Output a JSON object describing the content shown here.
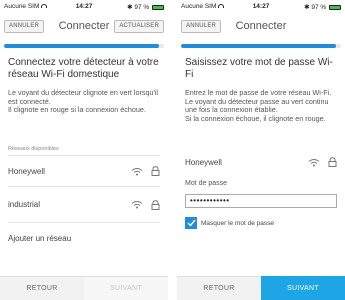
{
  "colors": {
    "accent": "#1f8ddb",
    "footer_active": "#1ea5e6",
    "battery": "#3cc152"
  },
  "left": {
    "status": {
      "carrier": "Aucune SIM",
      "time": "14:27",
      "battery": "97 %"
    },
    "nav": {
      "cancel": "ANNULER",
      "title": "Connecter",
      "refresh": "ACTUALISER"
    },
    "progress": 0.97,
    "heading": "Connectez votre détecteur à votre réseau Wi-Fi domestique",
    "description": "Le voyant du détecteur clignote en vert lorsqu'il est connecté.\nIl clignote en rouge si la connexion échoue.",
    "networks_label": "Réseaux disponibles",
    "networks": [
      {
        "name": "Honeywell",
        "icons": [
          "wifi-icon",
          "lock-icon"
        ]
      },
      {
        "name": "industrial",
        "icons": [
          "wifi-icon",
          "lock-icon"
        ]
      }
    ],
    "add_network": "Ajouter un réseau",
    "footer": {
      "back": "RETOUR",
      "next": "SUIVANT"
    }
  },
  "right": {
    "status": {
      "carrier": "Aucune SIM",
      "time": "14:27",
      "battery": "97 %"
    },
    "nav": {
      "cancel": "ANNULER",
      "title": "Connecter"
    },
    "progress": 0.97,
    "heading": "Saisissez votre mot de passe Wi-Fi",
    "description": "Entrez le mot de passe de votre réseau Wi-Fi. Le voyant du détecteur passe au vert continu une fois la connexion établie.\nSi la connexion échoue, il clignote en rouge.",
    "network": {
      "name": "Honeywell",
      "icons": [
        "wifi-icon",
        "lock-icon"
      ]
    },
    "password_label": "Mot de passe",
    "password_value": "••••••••••••",
    "show_password_label": "Masquer le mot de passe",
    "show_password_checked": true,
    "footer": {
      "back": "RETOUR",
      "next": "SUIVANT"
    }
  }
}
